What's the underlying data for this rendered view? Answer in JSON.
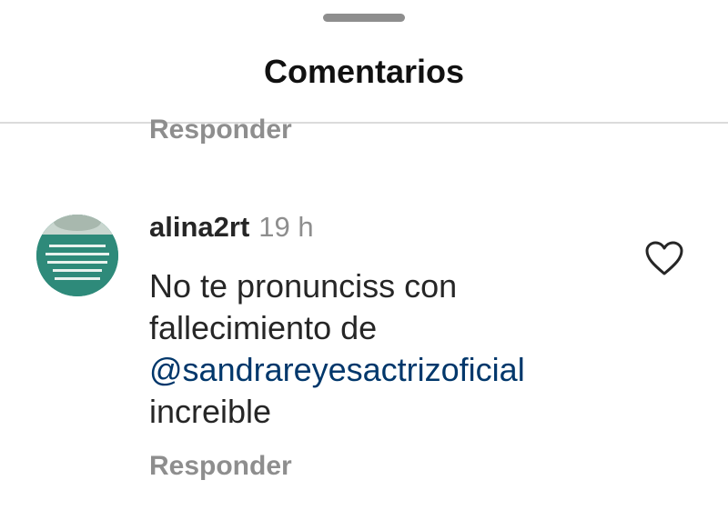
{
  "sheet": {
    "title": "Comentarios"
  },
  "previous_comment": {
    "reply_label": "Responder"
  },
  "comment": {
    "username": "alina2rt",
    "timestamp": "19 h",
    "text_line1": "No te pronunciss con",
    "text_line2": "fallecimiento de",
    "mention": "@sandrareyesactrizoficial",
    "text_line4": "increible",
    "reply_label": "Responder",
    "like_icon": "heart-outline-icon"
  },
  "colors": {
    "mention": "#00376b",
    "muted": "#8e8e8e",
    "text": "#262626",
    "avatar_bg": "#2e8a7a"
  }
}
